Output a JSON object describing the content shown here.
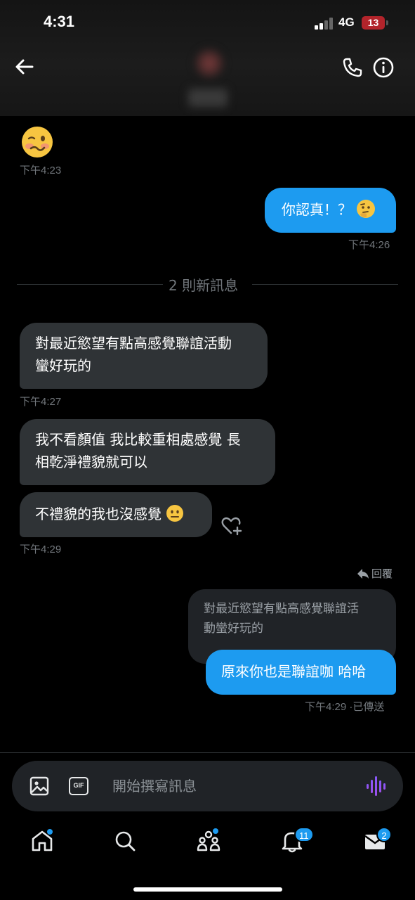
{
  "status_bar": {
    "time": "4:31",
    "network": "4G",
    "battery": "13"
  },
  "header": {
    "back_icon": "arrow-left-icon",
    "call_icon": "phone-icon",
    "info_icon": "info-icon"
  },
  "messages": [
    {
      "side": "in",
      "type": "emoji",
      "content_icon": "woozy-face-emoji",
      "time": "下午4:23"
    },
    {
      "side": "out",
      "text": "你認真！？",
      "emoji_icon": "thinking-face-emoji",
      "time": "下午4:26"
    },
    {
      "side": "in",
      "text_line1": "對最近慾望有點高感覺聯誼活動",
      "text_line2": "蠻好玩的",
      "time": "下午4:27"
    },
    {
      "side": "in",
      "text_line1": "我不看顏值 我比較重相處感覺 長",
      "text_line2": "相乾淨禮貌就可以"
    },
    {
      "side": "in",
      "text": "不禮貌的我也沒感覺",
      "emoji_icon": "neutral-face-emoji",
      "time": "下午4:29"
    },
    {
      "side": "out",
      "reply_label": "回覆",
      "quoted_line1": "對最近慾望有點高感覺聯誼活",
      "quoted_line2": "動蠻好玩的",
      "text": "原來你也是聯誼咖 哈哈",
      "time": "下午4:29",
      "status": "·已傳送"
    }
  ],
  "new_messages_divider": "2 則新訊息",
  "composer": {
    "placeholder": "開始撰寫訊息",
    "gif_label": "GIF"
  },
  "tab_bar": {
    "items": [
      {
        "name": "home",
        "icon": "home-icon",
        "has_dot": true
      },
      {
        "name": "search",
        "icon": "search-icon"
      },
      {
        "name": "communities",
        "icon": "people-icon",
        "has_dot": true
      },
      {
        "name": "notifications",
        "icon": "bell-icon",
        "badge": "11"
      },
      {
        "name": "messages",
        "icon": "mail-icon",
        "badge": "2"
      }
    ]
  },
  "colors": {
    "accent": "#1d9bf0",
    "incoming_bubble": "#2f3336",
    "timestamp": "#71767b"
  }
}
